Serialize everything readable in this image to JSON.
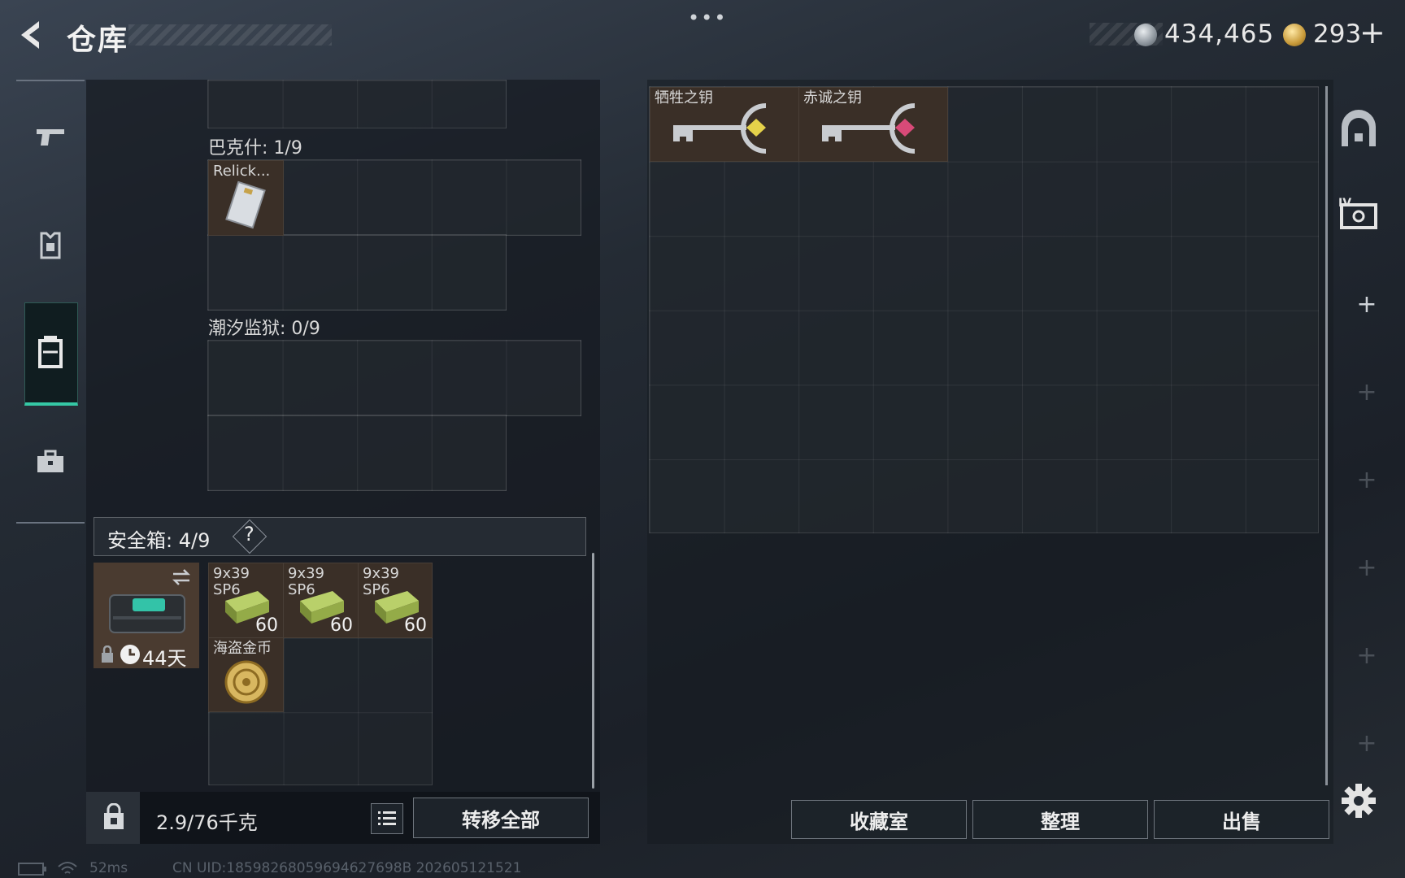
{
  "header": {
    "title": "仓库",
    "more": "•••",
    "silver": "434,465",
    "gold": "293",
    "gold_plus": "+"
  },
  "left_panel": {
    "section_bakshi": "巴克什: 1/9",
    "relic_item": "Relick...",
    "section_tide": "潮汐监狱: 0/9",
    "safe_label": "安全箱: 4/9",
    "safe_help": "?",
    "safe_timer": "44天",
    "ammo": [
      {
        "name": "9x39\nSP6",
        "count": "60"
      },
      {
        "name": "9x39\nSP6",
        "count": "60"
      },
      {
        "name": "9x39\nSP6",
        "count": "60"
      }
    ],
    "pirate_coin": "海盗金币",
    "weight": "2.9/76千克",
    "transfer_all": "转移全部"
  },
  "stash": {
    "keys": [
      "牺牲之钥",
      "赤诚之钥"
    ]
  },
  "bottom_buttons": {
    "collection": "收藏室",
    "sort": "整理",
    "sell": "出售"
  },
  "status": {
    "ping": "52ms",
    "uid": "CN UID:18598268059694627698B 202605121521"
  },
  "colors": {
    "accent": "#35c8a5",
    "item_bg": "#3a2f27"
  }
}
